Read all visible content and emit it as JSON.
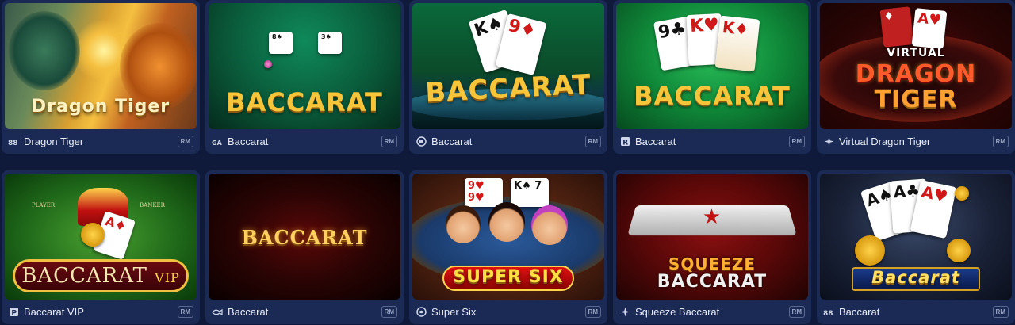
{
  "games": [
    {
      "name": "Dragon Tiger",
      "badge": "RM",
      "provider_icon": "provider-88-icon",
      "thumb_title": "Dragon Tiger"
    },
    {
      "name": "Baccarat",
      "badge": "RM",
      "provider_icon": "provider-ga-icon",
      "thumb_title": "BACCARAT"
    },
    {
      "name": "Baccarat",
      "badge": "RM",
      "provider_icon": "provider-cube-icon",
      "thumb_title": "BACCARAT"
    },
    {
      "name": "Baccarat",
      "badge": "RM",
      "provider_icon": "provider-r-icon",
      "thumb_title": "BACCARAT"
    },
    {
      "name": "Virtual Dragon Tiger",
      "badge": "RM",
      "provider_icon": "provider-star-icon",
      "thumb_title_1": "VIRTUAL",
      "thumb_title_2": "DRAGON",
      "thumb_title_3": "TIGER"
    },
    {
      "name": "Baccarat VIP",
      "badge": "RM",
      "provider_icon": "provider-p-icon",
      "thumb_title": "BACCARAT",
      "thumb_subtitle": "VIP",
      "thumb_player": "PLAYER",
      "thumb_banker": "BANKER"
    },
    {
      "name": "Baccarat",
      "badge": "RM",
      "provider_icon": "provider-fish-icon",
      "thumb_title": "BACCARAT"
    },
    {
      "name": "Super Six",
      "badge": "RM",
      "provider_icon": "provider-globe-icon",
      "thumb_title": "SUPER SIX"
    },
    {
      "name": "Squeeze Baccarat",
      "badge": "RM",
      "provider_icon": "provider-star-icon",
      "thumb_title_1": "SQUEEZE",
      "thumb_title_2": "BACCARAT"
    },
    {
      "name": "Baccarat",
      "badge": "RM",
      "provider_icon": "provider-88-icon",
      "thumb_title": "Baccarat"
    }
  ],
  "colors": {
    "page_bg": "#0f1a3a",
    "card_bg": "#1a2a55",
    "badge_border": "#5a6890"
  }
}
